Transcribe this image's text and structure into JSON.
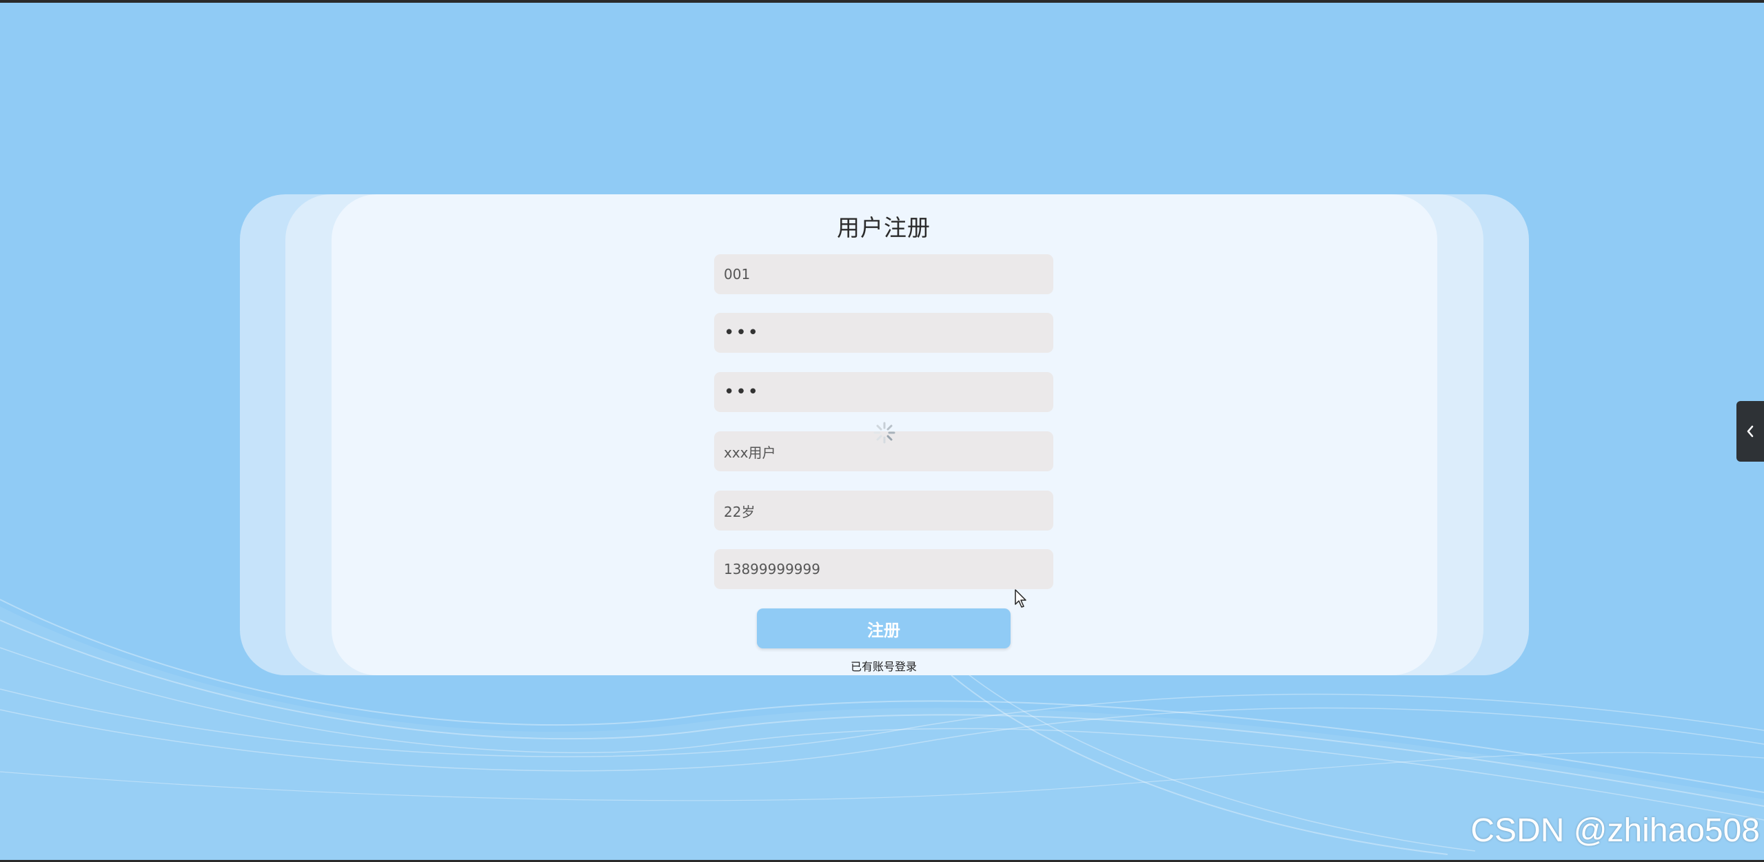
{
  "form": {
    "title": "用户注册",
    "fields": [
      {
        "name": "account",
        "value": "001",
        "type": "text"
      },
      {
        "name": "password",
        "value": "•••",
        "type": "password"
      },
      {
        "name": "confirm-password",
        "value": "•••",
        "type": "password"
      },
      {
        "name": "username",
        "value": "xxx用户",
        "type": "text"
      },
      {
        "name": "age",
        "value": "22岁",
        "type": "text"
      },
      {
        "name": "phone",
        "value": "13899999999",
        "type": "text"
      }
    ],
    "submit_label": "注册",
    "login_link": "已有账号登录"
  },
  "watermark": "CSDN @zhihao508",
  "colors": {
    "background": "#90cbf5",
    "card": "#eef6fe",
    "input": "#ebe9ea",
    "button": "#90cbf5"
  },
  "icons": {
    "side_tab": "chevron-left-icon",
    "loading": "spinner-icon",
    "cursor": "mouse-pointer-icon"
  }
}
